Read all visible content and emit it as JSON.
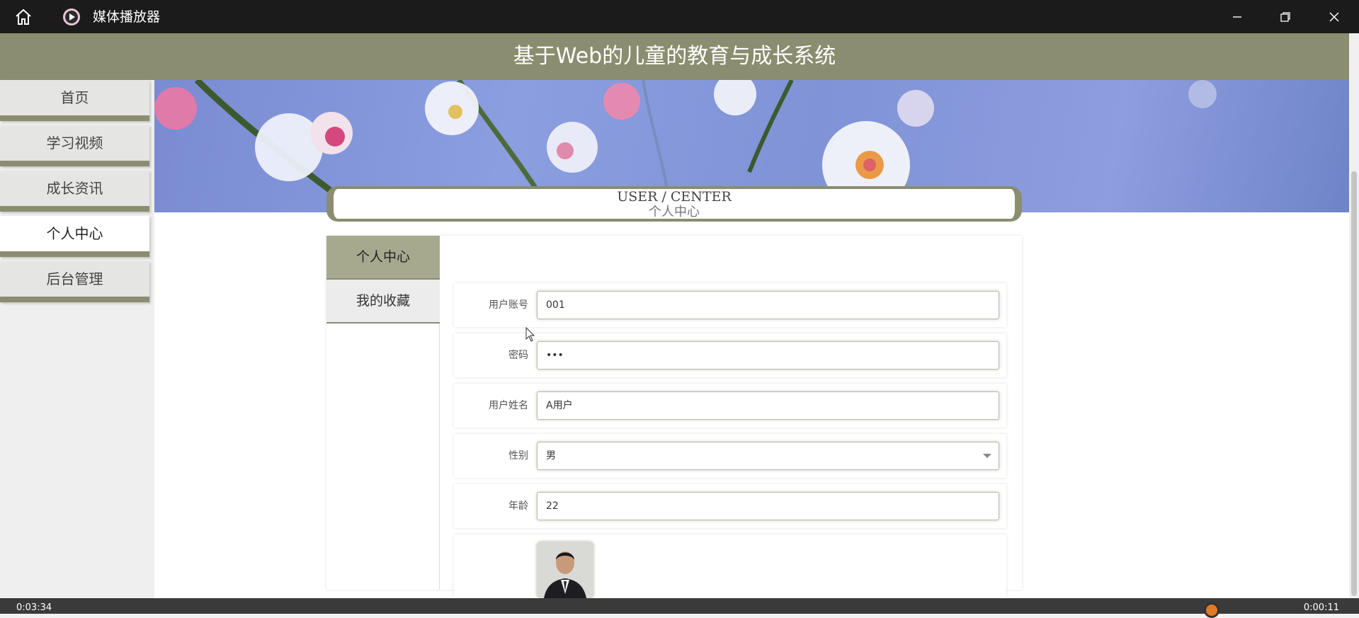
{
  "titlebar": {
    "app_name": "媒体播放器"
  },
  "header": {
    "title": "基于Web的儿童的教育与成长系统"
  },
  "sidebar": {
    "items": [
      {
        "label": "首页"
      },
      {
        "label": "学习视频"
      },
      {
        "label": "成长资讯"
      },
      {
        "label": "个人中心",
        "active": true
      },
      {
        "label": "后台管理"
      }
    ]
  },
  "banner": {
    "slides": 3,
    "active_slide": 1
  },
  "user_center": {
    "heading_en": "USER / CENTER",
    "heading_cn": "个人中心"
  },
  "subnav": {
    "items": [
      {
        "label": "个人中心",
        "active": true
      },
      {
        "label": "我的收藏"
      }
    ]
  },
  "form": {
    "account": {
      "label": "用户账号",
      "value": "001"
    },
    "password": {
      "label": "密码",
      "value": "•••"
    },
    "name": {
      "label": "用户姓名",
      "value": "A用户"
    },
    "gender": {
      "label": "性别",
      "value": "男"
    },
    "age": {
      "label": "年龄",
      "value": "22"
    }
  },
  "player": {
    "elapsed": "0:03:34",
    "remaining": "0:00:11"
  },
  "colors": {
    "accent": "#8a8d6f",
    "titlebar": "#1b1b1b"
  }
}
